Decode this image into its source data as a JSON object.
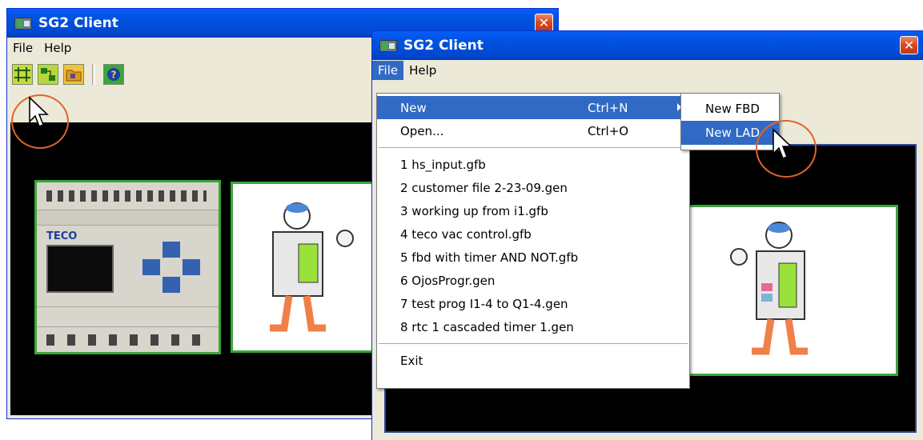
{
  "window_back": {
    "title": "SG2 Client",
    "menu": [
      "File",
      "Help"
    ],
    "toolbar": [
      "new-ladder-icon",
      "new-fbd-icon",
      "open-folder-icon",
      "help-icon"
    ]
  },
  "window_front": {
    "title": "SG2 Client",
    "menu": [
      "File",
      "Help"
    ],
    "file_menu": {
      "new": {
        "label": "New",
        "shortcut": "Ctrl+N"
      },
      "open": {
        "label": "Open...",
        "shortcut": "Ctrl+O"
      },
      "recent": [
        "1 hs_input.gfb",
        "2 customer file 2-23-09.gen",
        "3 working up from i1.gfb",
        "4 teco vac control.gfb",
        "5 fbd with timer AND NOT.gfb",
        "6 OjosProgr.gen",
        "7 test prog I1-4 to Q1-4.gen",
        "8 rtc 1 cascaded timer 1.gen"
      ],
      "exit": "Exit"
    },
    "new_submenu": [
      "New FBD",
      "New LAD"
    ]
  },
  "plc": {
    "brand": "TECO"
  },
  "colors": {
    "title_blue": "#0054e3",
    "highlight": "#316ac5",
    "panel_border": "#3aa53a",
    "callout": "#e0642a"
  }
}
